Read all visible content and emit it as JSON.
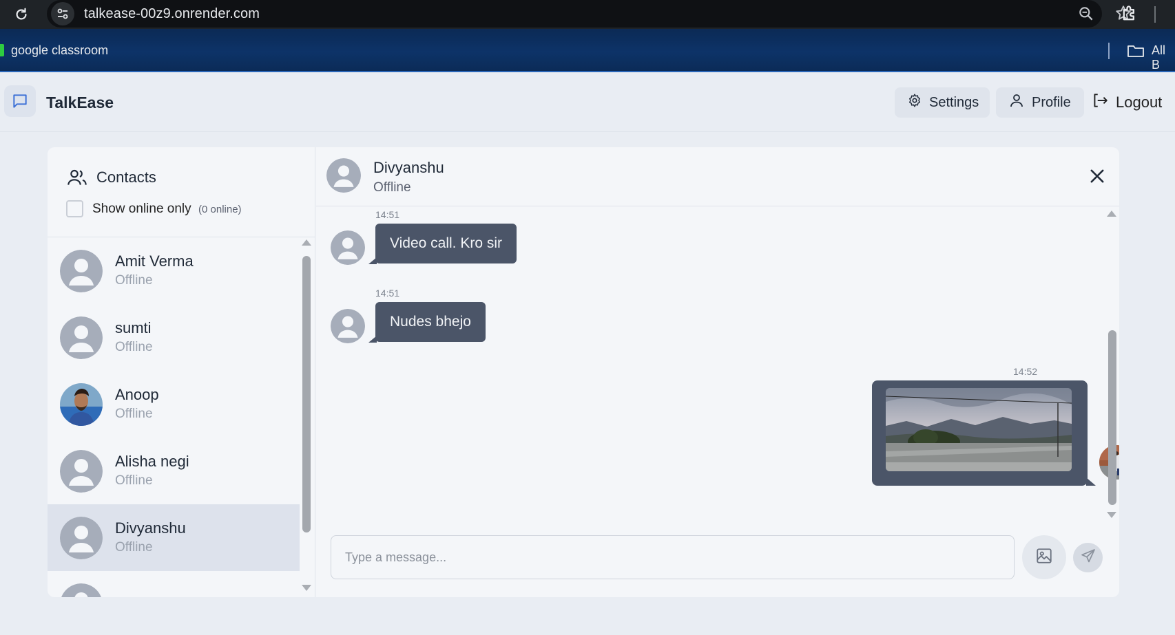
{
  "browser": {
    "url": "talkease-00z9.onrender.com",
    "bookmark_label": "google classroom",
    "bookmarks_all": "All B"
  },
  "header": {
    "app_name": "TalkEase",
    "settings_label": "Settings",
    "profile_label": "Profile",
    "logout_label": "Logout"
  },
  "sidebar": {
    "title": "Contacts",
    "online_toggle_label": "Show online only",
    "online_count": "(0 online)",
    "contacts": [
      {
        "name": "Amit Verma",
        "status": "Offline"
      },
      {
        "name": "sumti",
        "status": "Offline"
      },
      {
        "name": "Anoop",
        "status": "Offline"
      },
      {
        "name": "Alisha negi",
        "status": "Offline"
      },
      {
        "name": "Divyanshu",
        "status": "Offline"
      }
    ]
  },
  "chat": {
    "name": "Divyanshu",
    "status": "Offline",
    "messages": [
      {
        "time": "14:51",
        "text": "Video call. Kro sir",
        "direction": "incoming"
      },
      {
        "time": "14:51",
        "text": "Nudes bhejo",
        "direction": "incoming"
      },
      {
        "time": "14:52",
        "type": "image",
        "direction": "outgoing"
      }
    ],
    "input_placeholder": "Type a message..."
  },
  "colors": {
    "bubble": "#4b5568",
    "selected_contact": "#dde2ec",
    "page_bg": "#e9edf3"
  }
}
